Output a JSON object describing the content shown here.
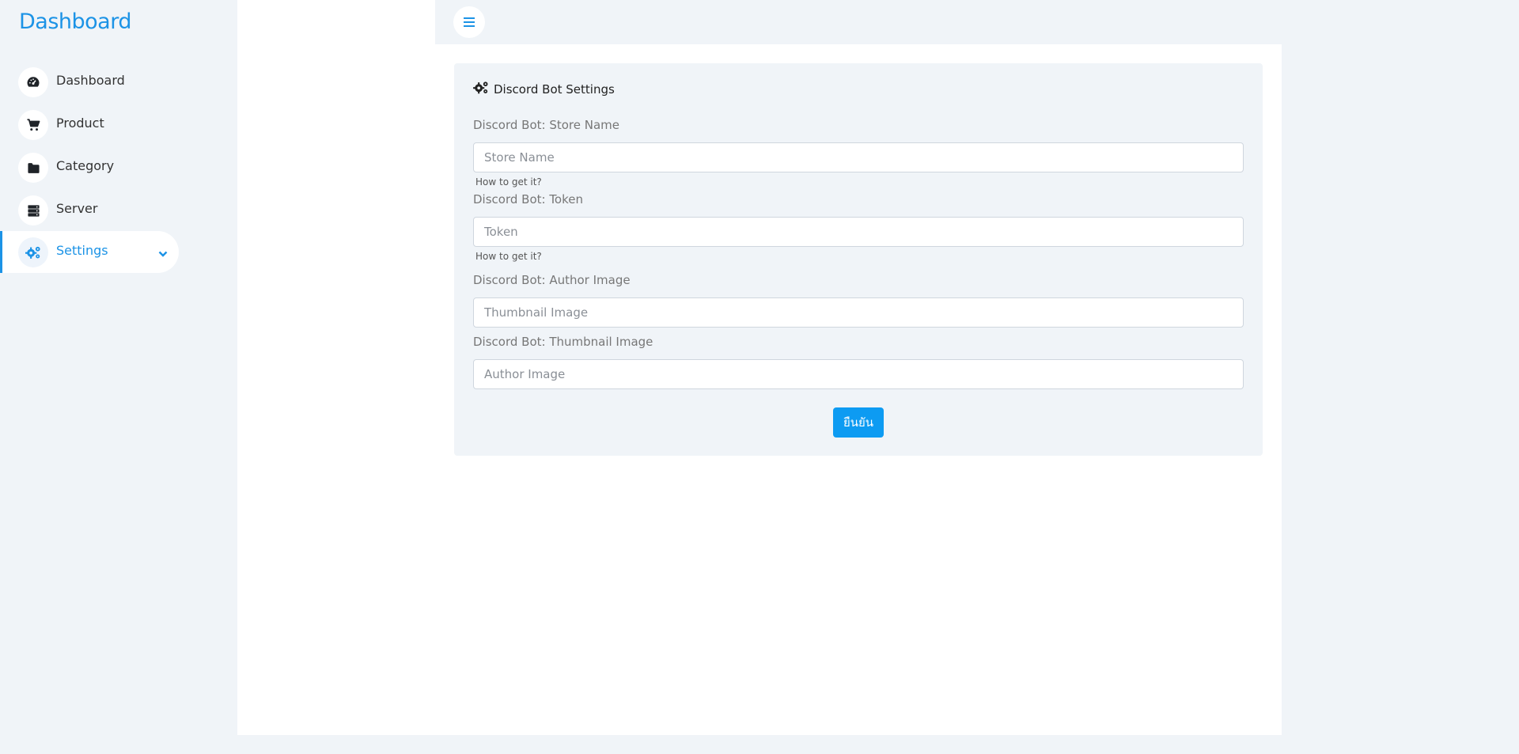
{
  "brand": {
    "title": "Dashboard"
  },
  "sidebar": {
    "items": [
      {
        "label": "Dashboard",
        "icon": "gauge-icon"
      },
      {
        "label": "Product",
        "icon": "cart-icon"
      },
      {
        "label": "Category",
        "icon": "folder-icon"
      },
      {
        "label": "Server",
        "icon": "server-icon"
      },
      {
        "label": "Settings",
        "icon": "gears-icon",
        "active": true
      }
    ]
  },
  "header": {
    "menu_icon": "hamburger-menu-icon"
  },
  "card": {
    "title": "Discord Bot Settings",
    "fields": [
      {
        "label": "Discord Bot: Store Name",
        "placeholder": "Store Name",
        "value": "",
        "help": "How to get it?"
      },
      {
        "label": "Discord Bot: Token",
        "placeholder": "Token",
        "value": "",
        "help": "How to get it?"
      },
      {
        "label": "Discord Bot: Author Image",
        "placeholder": "Thumbnail Image",
        "value": ""
      },
      {
        "label": "Discord Bot: Thumbnail Image",
        "placeholder": "Author Image",
        "value": ""
      }
    ],
    "submit_label": "ยืนยัน"
  },
  "colors": {
    "accent": "#1c93e6",
    "button": "#0d9bf2",
    "background": "#f0f4f8",
    "panel": "#ffffff"
  }
}
